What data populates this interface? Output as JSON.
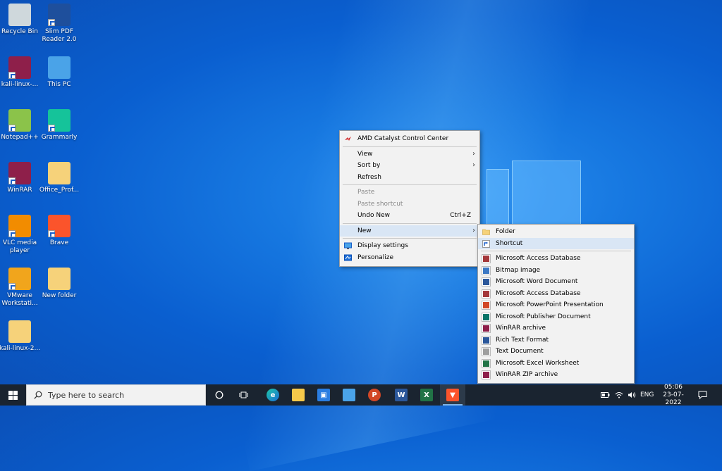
{
  "desktop": {
    "icons": [
      {
        "label": "Recycle Bin",
        "icon": "recycle-bin-icon",
        "color": "#cfd8dc"
      },
      {
        "label": "Slim PDF Reader 2.0",
        "icon": "slim-pdf-icon",
        "color": "#1e4f9c"
      },
      {
        "label": "kali-linux-...",
        "icon": "winrar-archive-icon",
        "color": "#8e1f4a"
      },
      {
        "label": "This PC",
        "icon": "this-pc-icon",
        "color": "#4aa3e8"
      },
      {
        "label": "Notepad++",
        "icon": "notepad-plus-plus-icon",
        "color": "#8bc34a"
      },
      {
        "label": "Grammarly",
        "icon": "grammarly-icon",
        "color": "#15c39a"
      },
      {
        "label": "WinRAR",
        "icon": "winrar-icon",
        "color": "#8e1f4a"
      },
      {
        "label": "Office_Prof...",
        "icon": "folder-icon",
        "color": "#f6d27a"
      },
      {
        "label": "VLC media player",
        "icon": "vlc-icon",
        "color": "#f28c00"
      },
      {
        "label": "Brave",
        "icon": "brave-icon",
        "color": "#fb542b"
      },
      {
        "label": "VMware Workstati...",
        "icon": "vmware-icon",
        "color": "#f1a51c"
      },
      {
        "label": "New folder",
        "icon": "folder-icon",
        "color": "#f6d27a"
      },
      {
        "label": "kali-linux-2...",
        "icon": "folder-icon",
        "color": "#f6d27a"
      }
    ]
  },
  "context_menu": {
    "amd": "AMD Catalyst Control Center",
    "view": "View",
    "sort_by": "Sort by",
    "refresh": "Refresh",
    "paste": "Paste",
    "paste_shortcut": "Paste shortcut",
    "undo_new": "Undo New",
    "undo_shortcut": "Ctrl+Z",
    "new": "New",
    "display_settings": "Display settings",
    "personalize": "Personalize"
  },
  "new_submenu": {
    "folder": "Folder",
    "shortcut": "Shortcut",
    "items": [
      {
        "label": "Microsoft Access Database",
        "icon": "access-icon",
        "color": "#a4373a"
      },
      {
        "label": "Bitmap image",
        "icon": "bitmap-icon",
        "color": "#3b78c4"
      },
      {
        "label": "Microsoft Word Document",
        "icon": "word-icon",
        "color": "#2b579a"
      },
      {
        "label": "Microsoft Access Database",
        "icon": "access-icon",
        "color": "#a4373a"
      },
      {
        "label": "Microsoft PowerPoint Presentation",
        "icon": "powerpoint-icon",
        "color": "#d24726"
      },
      {
        "label": "Microsoft Publisher Document",
        "icon": "publisher-icon",
        "color": "#077568"
      },
      {
        "label": "WinRAR archive",
        "icon": "winrar-archive-icon",
        "color": "#8e1f4a"
      },
      {
        "label": "Rich Text Format",
        "icon": "rtf-icon",
        "color": "#2b579a"
      },
      {
        "label": "Text Document",
        "icon": "text-document-icon",
        "color": "#9e9e9e"
      },
      {
        "label": "Microsoft Excel Worksheet",
        "icon": "excel-icon",
        "color": "#217346"
      },
      {
        "label": "WinRAR ZIP archive",
        "icon": "winrar-zip-icon",
        "color": "#8e1f4a"
      }
    ]
  },
  "taskbar": {
    "search_placeholder": "Type here to search",
    "language": "ENG",
    "time": "05:06",
    "date": "23-07-2022"
  }
}
